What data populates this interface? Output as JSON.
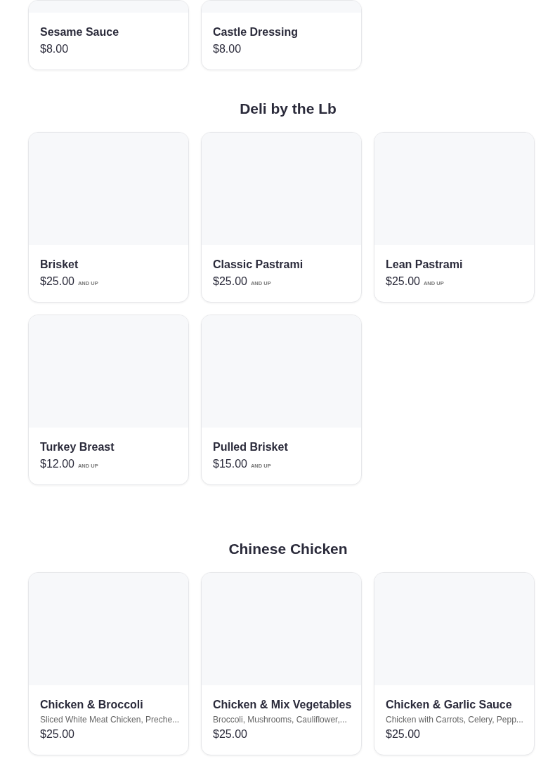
{
  "sections": [
    {
      "kind": "cropped",
      "items": [
        {
          "name": "Sesame Sauce",
          "price": "$8.00"
        },
        {
          "name": "Castle Dressing",
          "price": "$8.00"
        }
      ]
    },
    {
      "kind": "full",
      "title": "Deli by the Lb",
      "items": [
        {
          "name": "Brisket",
          "price": "$25.00",
          "note": "AND UP"
        },
        {
          "name": "Classic Pastrami",
          "price": "$25.00",
          "note": "AND UP"
        },
        {
          "name": "Lean Pastrami",
          "price": "$25.00",
          "note": "AND UP"
        },
        {
          "name": "Turkey Breast",
          "price": "$12.00",
          "note": "AND UP"
        },
        {
          "name": "Pulled Brisket",
          "price": "$15.00",
          "note": "AND UP"
        }
      ]
    },
    {
      "kind": "full",
      "title": "Chinese Chicken",
      "items": [
        {
          "name": "Chicken & Broccoli",
          "description": "Sliced White Meat Chicken, Preche...",
          "price": "$25.00"
        },
        {
          "name": "Chicken & Mix Vegetables",
          "description": "Broccoli, Mushrooms, Cauliflower,...",
          "price": "$25.00"
        },
        {
          "name": "Chicken & Garlic Sauce",
          "description": "Chicken with Carrots, Celery, Pepp...",
          "price": "$25.00"
        }
      ]
    }
  ]
}
